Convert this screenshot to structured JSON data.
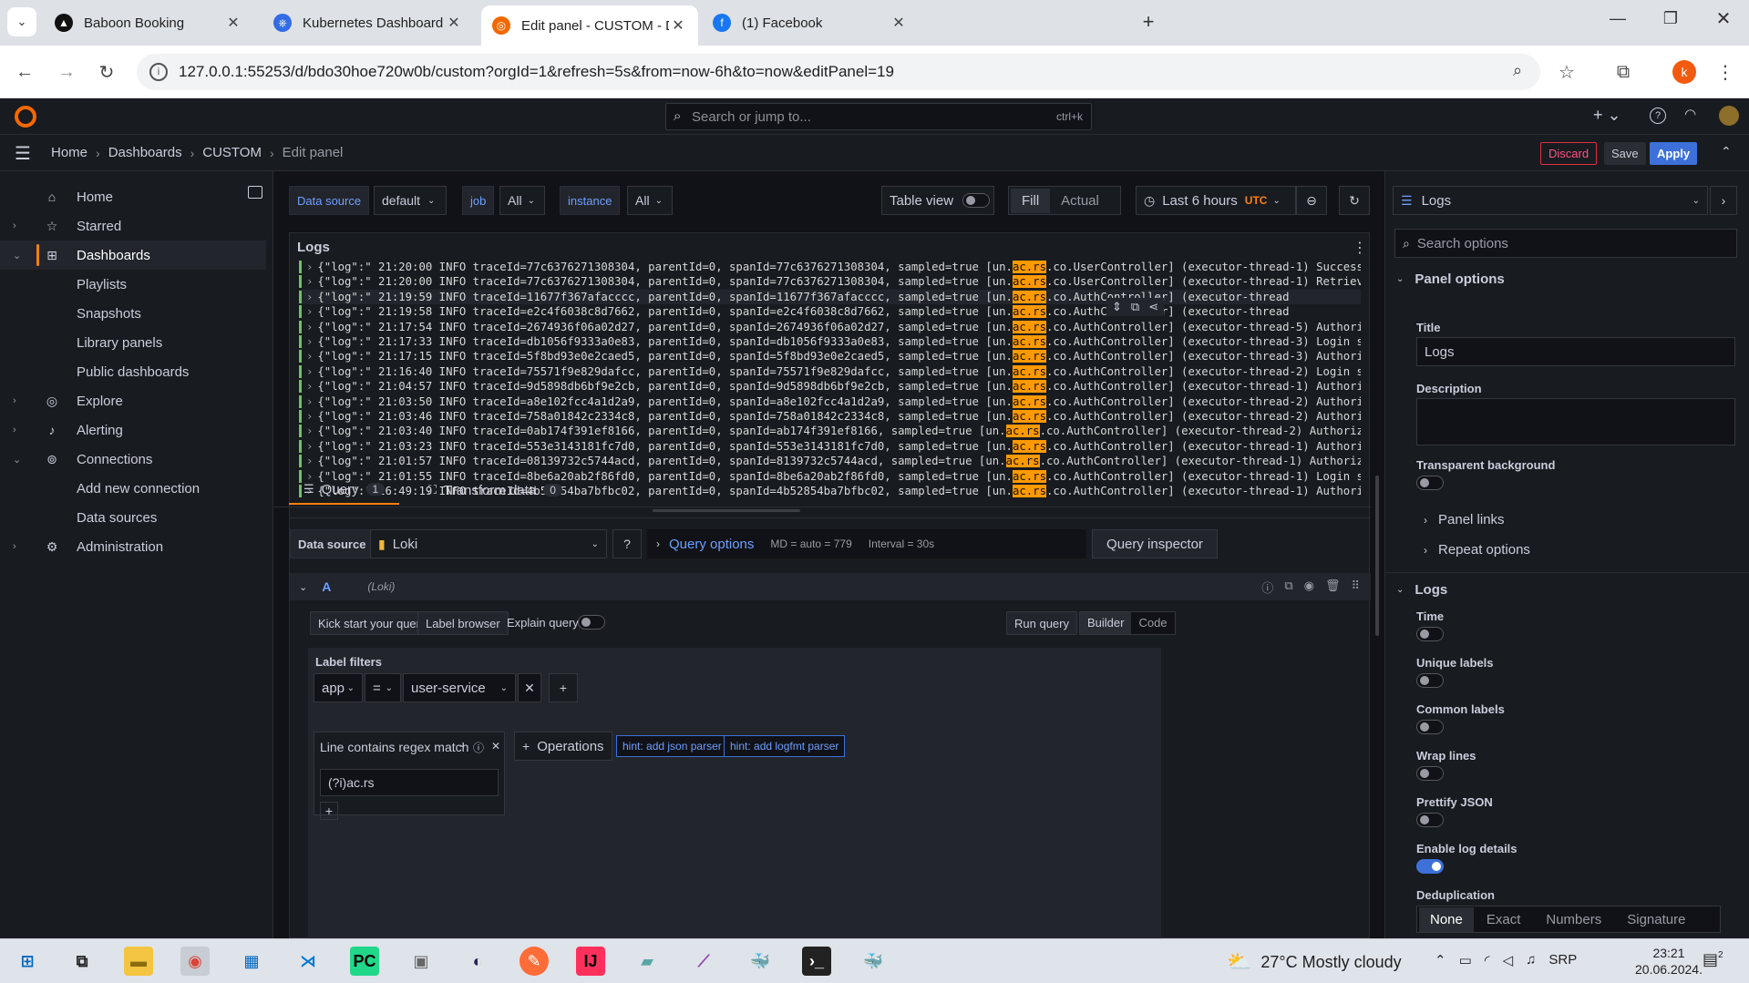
{
  "browser": {
    "tabs": [
      {
        "title": "Baboon Booking",
        "icon": "baboon-icon"
      },
      {
        "title": "Kubernetes Dashboard",
        "icon": "kubernetes-icon"
      },
      {
        "title": "Edit panel - CUSTOM - Dashbo",
        "icon": "grafana-icon"
      },
      {
        "title": "(1) Facebook",
        "icon": "facebook-icon"
      }
    ],
    "url": "127.0.0.1:55253/d/bdo30hoe720w0b/custom?orgId=1&refresh=5s&from=now-6h&to=now&editPanel=19",
    "profile_initial": "k"
  },
  "grafana": {
    "search_placeholder": "Search or jump to...",
    "search_shortcut": "ctrl+k",
    "breadcrumb": [
      "Home",
      "Dashboards",
      "CUSTOM",
      "Edit panel"
    ],
    "actions": {
      "discard": "Discard",
      "save": "Save",
      "apply": "Apply"
    }
  },
  "sidebar": {
    "items": [
      {
        "label": "Home",
        "icon": "home-icon",
        "chevron": ""
      },
      {
        "label": "Starred",
        "icon": "star-icon",
        "chevron": "›"
      },
      {
        "label": "Dashboards",
        "icon": "dashboards-icon",
        "chevron": "⌄"
      },
      {
        "label": "Playlists",
        "icon": "",
        "chevron": ""
      },
      {
        "label": "Snapshots",
        "icon": "",
        "chevron": ""
      },
      {
        "label": "Library panels",
        "icon": "",
        "chevron": ""
      },
      {
        "label": "Public dashboards",
        "icon": "",
        "chevron": ""
      },
      {
        "label": "Explore",
        "icon": "compass-icon",
        "chevron": "›"
      },
      {
        "label": "Alerting",
        "icon": "bell-icon",
        "chevron": "›"
      },
      {
        "label": "Connections",
        "icon": "connections-icon",
        "chevron": "⌄"
      },
      {
        "label": "Add new connection",
        "icon": "",
        "chevron": ""
      },
      {
        "label": "Data sources",
        "icon": "",
        "chevron": ""
      },
      {
        "label": "Administration",
        "icon": "gear-icon",
        "chevron": "›"
      }
    ]
  },
  "toolbar": {
    "datasource_label": "Data source",
    "datasource_value": "default",
    "job_label": "job",
    "job_value": "All",
    "instance_label": "instance",
    "instance_value": "All",
    "table_view": "Table view",
    "fill": "Fill",
    "actual": "Actual",
    "time_range": "Last 6 hours",
    "timezone": "UTC"
  },
  "panel": {
    "title": "Logs",
    "highlight": "ac.rs",
    "lines": [
      {
        "pre": "{\"log\":\" 21:20:00 INFO  traceId=77c6376271308304, parentId=0, spanId=77c6376271308304, sampled=true [un.",
        "post": ".co.UserController] (executor-thread-1) Success"
      },
      {
        "pre": "{\"log\":\" 21:20:00 INFO  traceId=77c6376271308304, parentId=0, spanId=77c6376271308304, sampled=true [un.",
        "post": ".co.UserController] (executor-thread-1) Retriev"
      },
      {
        "pre": "{\"log\":\" 21:19:59 INFO  traceId=11677f367afacccc, parentId=0, spanId=11677f367afacccc, sampled=true [un.",
        "post": ".co.AuthController] (executor-thread"
      },
      {
        "pre": "{\"log\":\" 21:19:58 INFO  traceId=e2c4f6038c8d7662, parentId=0, spanId=e2c4f6038c8d7662, sampled=true [un.",
        "post": ".co.AuthController] (executor-thread"
      },
      {
        "pre": "{\"log\":\" 21:17:54 INFO  traceId=2674936f06a02d27, parentId=0, spanId=2674936f06a02d27, sampled=true [un.",
        "post": ".co.AuthController] (executor-thread-5) Authori"
      },
      {
        "pre": "{\"log\":\" 21:17:33 INFO  traceId=db1056f9333a0e83, parentId=0, spanId=db1056f9333a0e83, sampled=true [un.",
        "post": ".co.AuthController] (executor-thread-3) Login s"
      },
      {
        "pre": "{\"log\":\" 21:17:15 INFO  traceId=5f8bd93e0e2caed5, parentId=0, spanId=5f8bd93e0e2caed5, sampled=true [un.",
        "post": ".co.AuthController] (executor-thread-3) Authori"
      },
      {
        "pre": "{\"log\":\" 21:16:40 INFO  traceId=75571f9e829dafcc, parentId=0, spanId=75571f9e829dafcc, sampled=true [un.",
        "post": ".co.AuthController] (executor-thread-2) Login s"
      },
      {
        "pre": "{\"log\":\" 21:04:57 INFO  traceId=9d5898db6bf9e2cb, parentId=0, spanId=9d5898db6bf9e2cb, sampled=true [un.",
        "post": ".co.AuthController] (executor-thread-1) Authori"
      },
      {
        "pre": "{\"log\":\" 21:03:50 INFO  traceId=a8e102fcc4a1d2a9, parentId=0, spanId=a8e102fcc4a1d2a9, sampled=true [un.",
        "post": ".co.AuthController] (executor-thread-2) Authori"
      },
      {
        "pre": "{\"log\":\" 21:03:46 INFO  traceId=758a01842c2334c8, parentId=0, spanId=758a01842c2334c8, sampled=true [un.",
        "post": ".co.AuthController] (executor-thread-2) Authori"
      },
      {
        "pre": "{\"log\":\" 21:03:40 INFO  traceId=0ab174f391ef8166, parentId=0, spanId=ab174f391ef8166, sampled=true [un.",
        "post": ".co.AuthController] (executor-thread-2) Authoriz"
      },
      {
        "pre": "{\"log\":\" 21:03:23 INFO  traceId=553e3143181fc7d0, parentId=0, spanId=553e3143181fc7d0, sampled=true [un.",
        "post": ".co.AuthController] (executor-thread-1) Authori"
      },
      {
        "pre": "{\"log\":\" 21:01:57 INFO  traceId=08139732c5744acd, parentId=0, spanId=8139732c5744acd, sampled=true [un.",
        "post": ".co.AuthController] (executor-thread-1) Authoriz"
      },
      {
        "pre": "{\"log\":\" 21:01:55 INFO  traceId=8be6a20ab2f86fd0, parentId=0, spanId=8be6a20ab2f86fd0, sampled=true [un.",
        "post": ".co.AuthController] (executor-thread-1) Login s"
      },
      {
        "pre": "{\"log\":\" 16:49:19 INFO  traceId=4b52854ba7bfbc02, parentId=0, spanId=4b52854ba7bfbc02, sampled=true [un.",
        "post": ".co.AuthController] (executor-thread-1) Authori"
      }
    ]
  },
  "query": {
    "tab_query": "Query",
    "tab_query_count": "1",
    "tab_transform": "Transform data",
    "tab_transform_count": "0",
    "datasource_label": "Data source",
    "datasource_value": "Loki",
    "query_options": "Query options",
    "md": "MD = auto = 779",
    "interval": "Interval = 30s",
    "inspector": "Query inspector",
    "row_letter": "A",
    "row_source": "(Loki)",
    "kick_start": "Kick start your query",
    "label_browser": "Label browser",
    "explain_query": "Explain query",
    "run_query": "Run query",
    "builder": "Builder",
    "code": "Code",
    "label_filters": "Label filters",
    "filter_key": "app",
    "filter_op": "=",
    "filter_value": "user-service",
    "line_filter": "Line contains regex match",
    "line_filter_value": "(?i)ac.rs",
    "operations": "Operations",
    "hint_json": "hint: add json parser",
    "hint_logfmt": "hint: add logfmt parser"
  },
  "options": {
    "viz": "Logs",
    "search_placeholder": "Search options",
    "panel_options": "Panel options",
    "title_label": "Title",
    "title_value": "Logs",
    "description_label": "Description",
    "transparent_label": "Transparent background",
    "panel_links": "Panel links",
    "repeat_options": "Repeat options",
    "logs_section": "Logs",
    "time": "Time",
    "unique_labels": "Unique labels",
    "common_labels": "Common labels",
    "wrap_lines": "Wrap lines",
    "prettify_json": "Prettify JSON",
    "enable_log_details": "Enable log details",
    "deduplication": "Deduplication",
    "dedup_options": [
      "None",
      "Exact",
      "Numbers",
      "Signature"
    ]
  },
  "taskbar": {
    "weather": "27°C  Mostly cloudy",
    "lang": "SRP",
    "time": "23:21",
    "date": "20.06.2024.",
    "notifications": "2"
  },
  "colors": {
    "accent": "#3d71d9",
    "highlight": "#ff9900",
    "discard": "#e02f44",
    "grafana_orange": "#ff7f0e"
  }
}
